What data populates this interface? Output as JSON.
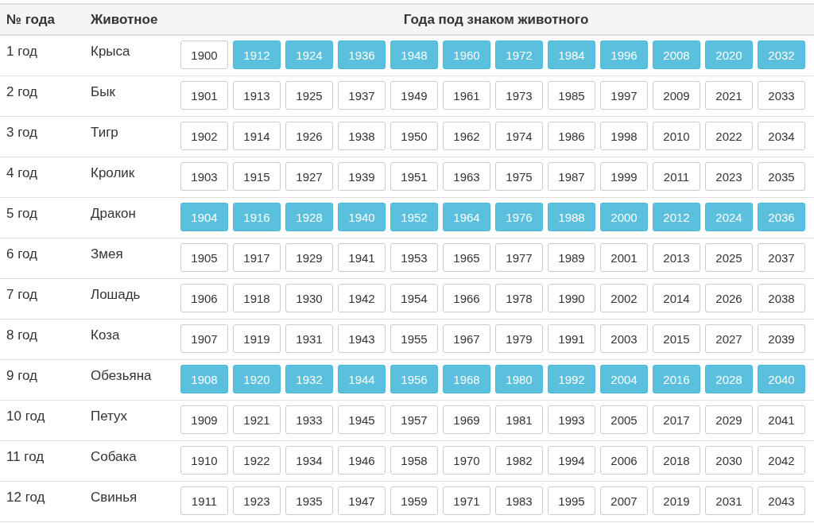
{
  "table": {
    "columns": [
      "№ года",
      "Животное",
      "Года под знаком животного"
    ],
    "rows": [
      {
        "number": "1 год",
        "animal": "Крыса",
        "years": [
          {
            "label": "1900",
            "selected": false
          },
          {
            "label": "1912",
            "selected": true
          },
          {
            "label": "1924",
            "selected": true
          },
          {
            "label": "1936",
            "selected": true
          },
          {
            "label": "1948",
            "selected": true
          },
          {
            "label": "1960",
            "selected": true
          },
          {
            "label": "1972",
            "selected": true
          },
          {
            "label": "1984",
            "selected": true
          },
          {
            "label": "1996",
            "selected": true
          },
          {
            "label": "2008",
            "selected": true
          },
          {
            "label": "2020",
            "selected": true
          },
          {
            "label": "2032",
            "selected": true
          }
        ]
      },
      {
        "number": "2 год",
        "animal": "Бык",
        "years": [
          {
            "label": "1901",
            "selected": false
          },
          {
            "label": "1913",
            "selected": false
          },
          {
            "label": "1925",
            "selected": false
          },
          {
            "label": "1937",
            "selected": false
          },
          {
            "label": "1949",
            "selected": false
          },
          {
            "label": "1961",
            "selected": false
          },
          {
            "label": "1973",
            "selected": false
          },
          {
            "label": "1985",
            "selected": false
          },
          {
            "label": "1997",
            "selected": false
          },
          {
            "label": "2009",
            "selected": false
          },
          {
            "label": "2021",
            "selected": false
          },
          {
            "label": "2033",
            "selected": false
          }
        ]
      },
      {
        "number": "3 год",
        "animal": "Тигр",
        "years": [
          {
            "label": "1902",
            "selected": false
          },
          {
            "label": "1914",
            "selected": false
          },
          {
            "label": "1926",
            "selected": false
          },
          {
            "label": "1938",
            "selected": false
          },
          {
            "label": "1950",
            "selected": false
          },
          {
            "label": "1962",
            "selected": false
          },
          {
            "label": "1974",
            "selected": false
          },
          {
            "label": "1986",
            "selected": false
          },
          {
            "label": "1998",
            "selected": false
          },
          {
            "label": "2010",
            "selected": false
          },
          {
            "label": "2022",
            "selected": false
          },
          {
            "label": "2034",
            "selected": false
          }
        ]
      },
      {
        "number": "4 год",
        "animal": "Кролик",
        "years": [
          {
            "label": "1903",
            "selected": false
          },
          {
            "label": "1915",
            "selected": false
          },
          {
            "label": "1927",
            "selected": false
          },
          {
            "label": "1939",
            "selected": false
          },
          {
            "label": "1951",
            "selected": false
          },
          {
            "label": "1963",
            "selected": false
          },
          {
            "label": "1975",
            "selected": false
          },
          {
            "label": "1987",
            "selected": false
          },
          {
            "label": "1999",
            "selected": false
          },
          {
            "label": "2011",
            "selected": false
          },
          {
            "label": "2023",
            "selected": false
          },
          {
            "label": "2035",
            "selected": false
          }
        ]
      },
      {
        "number": "5 год",
        "animal": "Дракон",
        "years": [
          {
            "label": "1904",
            "selected": true
          },
          {
            "label": "1916",
            "selected": true
          },
          {
            "label": "1928",
            "selected": true
          },
          {
            "label": "1940",
            "selected": true
          },
          {
            "label": "1952",
            "selected": true
          },
          {
            "label": "1964",
            "selected": true
          },
          {
            "label": "1976",
            "selected": true
          },
          {
            "label": "1988",
            "selected": true
          },
          {
            "label": "2000",
            "selected": true
          },
          {
            "label": "2012",
            "selected": true
          },
          {
            "label": "2024",
            "selected": true
          },
          {
            "label": "2036",
            "selected": true
          }
        ]
      },
      {
        "number": "6 год",
        "animal": "Змея",
        "years": [
          {
            "label": "1905",
            "selected": false
          },
          {
            "label": "1917",
            "selected": false
          },
          {
            "label": "1929",
            "selected": false
          },
          {
            "label": "1941",
            "selected": false
          },
          {
            "label": "1953",
            "selected": false
          },
          {
            "label": "1965",
            "selected": false
          },
          {
            "label": "1977",
            "selected": false
          },
          {
            "label": "1989",
            "selected": false
          },
          {
            "label": "2001",
            "selected": false
          },
          {
            "label": "2013",
            "selected": false
          },
          {
            "label": "2025",
            "selected": false
          },
          {
            "label": "2037",
            "selected": false
          }
        ]
      },
      {
        "number": "7 год",
        "animal": "Лошадь",
        "years": [
          {
            "label": "1906",
            "selected": false
          },
          {
            "label": "1918",
            "selected": false
          },
          {
            "label": "1930",
            "selected": false
          },
          {
            "label": "1942",
            "selected": false
          },
          {
            "label": "1954",
            "selected": false
          },
          {
            "label": "1966",
            "selected": false
          },
          {
            "label": "1978",
            "selected": false
          },
          {
            "label": "1990",
            "selected": false
          },
          {
            "label": "2002",
            "selected": false
          },
          {
            "label": "2014",
            "selected": false
          },
          {
            "label": "2026",
            "selected": false
          },
          {
            "label": "2038",
            "selected": false
          }
        ]
      },
      {
        "number": "8 год",
        "animal": "Коза",
        "years": [
          {
            "label": "1907",
            "selected": false
          },
          {
            "label": "1919",
            "selected": false
          },
          {
            "label": "1931",
            "selected": false
          },
          {
            "label": "1943",
            "selected": false
          },
          {
            "label": "1955",
            "selected": false
          },
          {
            "label": "1967",
            "selected": false
          },
          {
            "label": "1979",
            "selected": false
          },
          {
            "label": "1991",
            "selected": false
          },
          {
            "label": "2003",
            "selected": false
          },
          {
            "label": "2015",
            "selected": false
          },
          {
            "label": "2027",
            "selected": false
          },
          {
            "label": "2039",
            "selected": false
          }
        ]
      },
      {
        "number": "9 год",
        "animal": "Обезьяна",
        "years": [
          {
            "label": "1908",
            "selected": true
          },
          {
            "label": "1920",
            "selected": true
          },
          {
            "label": "1932",
            "selected": true
          },
          {
            "label": "1944",
            "selected": true
          },
          {
            "label": "1956",
            "selected": true
          },
          {
            "label": "1968",
            "selected": true
          },
          {
            "label": "1980",
            "selected": true
          },
          {
            "label": "1992",
            "selected": true
          },
          {
            "label": "2004",
            "selected": true
          },
          {
            "label": "2016",
            "selected": true
          },
          {
            "label": "2028",
            "selected": true
          },
          {
            "label": "2040",
            "selected": true
          }
        ]
      },
      {
        "number": "10 год",
        "animal": "Петух",
        "years": [
          {
            "label": "1909",
            "selected": false
          },
          {
            "label": "1921",
            "selected": false
          },
          {
            "label": "1933",
            "selected": false
          },
          {
            "label": "1945",
            "selected": false
          },
          {
            "label": "1957",
            "selected": false
          },
          {
            "label": "1969",
            "selected": false
          },
          {
            "label": "1981",
            "selected": false
          },
          {
            "label": "1993",
            "selected": false
          },
          {
            "label": "2005",
            "selected": false
          },
          {
            "label": "2017",
            "selected": false
          },
          {
            "label": "2029",
            "selected": false
          },
          {
            "label": "2041",
            "selected": false
          }
        ]
      },
      {
        "number": "11 год",
        "animal": "Собака",
        "years": [
          {
            "label": "1910",
            "selected": false
          },
          {
            "label": "1922",
            "selected": false
          },
          {
            "label": "1934",
            "selected": false
          },
          {
            "label": "1946",
            "selected": false
          },
          {
            "label": "1958",
            "selected": false
          },
          {
            "label": "1970",
            "selected": false
          },
          {
            "label": "1982",
            "selected": false
          },
          {
            "label": "1994",
            "selected": false
          },
          {
            "label": "2006",
            "selected": false
          },
          {
            "label": "2018",
            "selected": false
          },
          {
            "label": "2030",
            "selected": false
          },
          {
            "label": "2042",
            "selected": false
          }
        ]
      },
      {
        "number": "12 год",
        "animal": "Свинья",
        "years": [
          {
            "label": "1911",
            "selected": false
          },
          {
            "label": "1923",
            "selected": false
          },
          {
            "label": "1935",
            "selected": false
          },
          {
            "label": "1947",
            "selected": false
          },
          {
            "label": "1959",
            "selected": false
          },
          {
            "label": "1971",
            "selected": false
          },
          {
            "label": "1983",
            "selected": false
          },
          {
            "label": "1995",
            "selected": false
          },
          {
            "label": "2007",
            "selected": false
          },
          {
            "label": "2019",
            "selected": false
          },
          {
            "label": "2031",
            "selected": false
          },
          {
            "label": "2043",
            "selected": false
          }
        ]
      }
    ]
  }
}
